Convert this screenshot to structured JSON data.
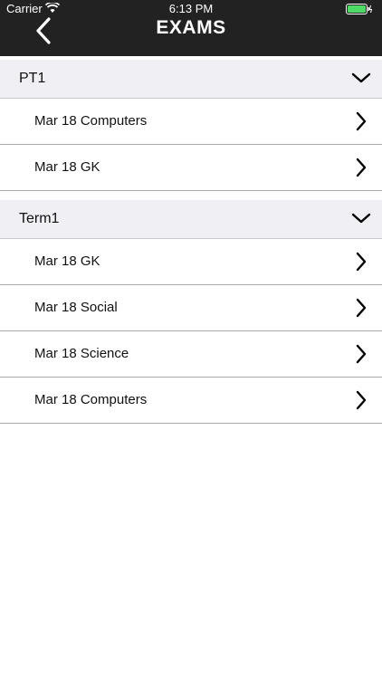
{
  "status_bar": {
    "carrier": "Carrier",
    "time": "6:13 PM"
  },
  "nav": {
    "title": "EXAMS"
  },
  "colors": {
    "bar_bg": "#222222",
    "header_bg": "#efeff4",
    "battery": "#4cd964"
  },
  "sections": [
    {
      "title": "PT1",
      "items": [
        {
          "label": "Mar 18 Computers"
        },
        {
          "label": "Mar 18 GK"
        }
      ]
    },
    {
      "title": "Term1",
      "items": [
        {
          "label": "Mar 18 GK"
        },
        {
          "label": "Mar 18 Social"
        },
        {
          "label": "Mar 18 Science"
        },
        {
          "label": "Mar 18 Computers"
        }
      ]
    }
  ]
}
